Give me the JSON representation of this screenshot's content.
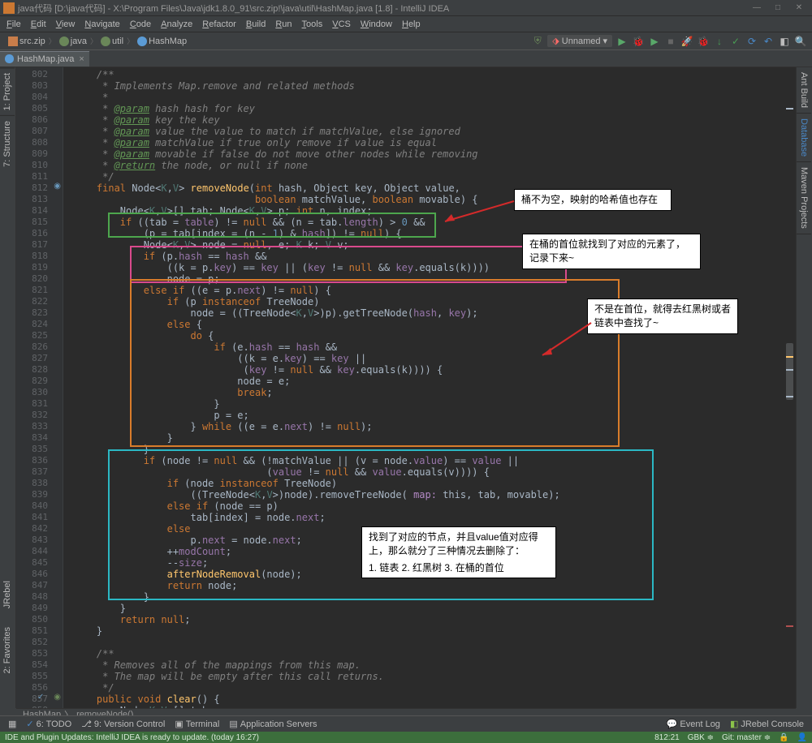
{
  "title": "java代码 [D:\\java代码] - X:\\Program Files\\Java\\jdk1.8.0_91\\src.zip!\\java\\util\\HashMap.java [1.8] - IntelliJ IDEA",
  "menu": [
    "File",
    "Edit",
    "View",
    "Navigate",
    "Code",
    "Analyze",
    "Refactor",
    "Build",
    "Run",
    "Tools",
    "VCS",
    "Window",
    "Help"
  ],
  "breadcrumbs": [
    {
      "icon": "zip",
      "label": "src.zip"
    },
    {
      "icon": "pkg",
      "label": "java"
    },
    {
      "icon": "pkg",
      "label": "util"
    },
    {
      "icon": "cls",
      "label": "HashMap"
    }
  ],
  "run_config": "Unnamed",
  "file_tab": "HashMap.java",
  "side_left": [
    "1: Project",
    "7: Structure"
  ],
  "side_left_bottom": [
    "JRebel",
    "2: Favorites"
  ],
  "side_right": [
    "Ant Build",
    "Database",
    "Maven Projects"
  ],
  "editor_footer": {
    "class": "HashMap",
    "method": "removeNode()"
  },
  "bottom_tools_left": [
    "6: TODO",
    "9: Version Control",
    "Terminal",
    "Application Servers"
  ],
  "bottom_tools_right": [
    "Event Log",
    "JRebel Console"
  ],
  "status_msg": "IDE and Plugin Updates: IntelliJ IDEA is ready to update. (today 16:27)",
  "status_right": {
    "pos": "812:21",
    "enc": "GBK",
    "git": "Git: master"
  },
  "line_start": 802,
  "code_lines": [
    {
      "t": "cmt",
      "s": "    /**"
    },
    {
      "t": "cmt",
      "s": "     * Implements Map.remove and related methods"
    },
    {
      "t": "cmt",
      "s": "     *"
    },
    {
      "t": "tag",
      "s": "     * @param hash hash for key"
    },
    {
      "t": "tag",
      "s": "     * @param key the key"
    },
    {
      "t": "tag",
      "s": "     * @param value the value to match if matchValue, else ignored"
    },
    {
      "t": "tag",
      "s": "     * @param matchValue if true only remove if value is equal"
    },
    {
      "t": "tag",
      "s": "     * @param movable if false do not move other nodes while removing"
    },
    {
      "t": "tag",
      "s": "     * @return the node, or null if none"
    },
    {
      "t": "cmt",
      "s": "     */"
    },
    {
      "t": "sig",
      "s": "    final Node<K,V> removeNode(int hash, Object key, Object value,"
    },
    {
      "t": "sig2",
      "s": "                               boolean matchValue, boolean movable) {"
    },
    {
      "t": "decl",
      "s": "        Node<K,V>[] tab; Node<K,V> p; int n, index;"
    },
    {
      "t": "code",
      "s": "        if ((tab = table) != null && (n = tab.length) > 0 &&"
    },
    {
      "t": "code",
      "s": "            (p = tab[index = (n - 1) & hash]) != null) {"
    },
    {
      "t": "decl",
      "s": "            Node<K,V> node = null, e; K k; V v;"
    },
    {
      "t": "code",
      "s": "            if (p.hash == hash &&"
    },
    {
      "t": "code",
      "s": "                ((k = p.key) == key || (key != null && key.equals(k))))"
    },
    {
      "t": "code",
      "s": "                node = p;"
    },
    {
      "t": "code",
      "s": "            else if ((e = p.next) != null) {"
    },
    {
      "t": "code",
      "s": "                if (p instanceof TreeNode)"
    },
    {
      "t": "code",
      "s": "                    node = ((TreeNode<K,V>)p).getTreeNode(hash, key);"
    },
    {
      "t": "code",
      "s": "                else {"
    },
    {
      "t": "code",
      "s": "                    do {"
    },
    {
      "t": "code",
      "s": "                        if (e.hash == hash &&"
    },
    {
      "t": "code",
      "s": "                            ((k = e.key) == key ||"
    },
    {
      "t": "code",
      "s": "                             (key != null && key.equals(k)))) {"
    },
    {
      "t": "code",
      "s": "                            node = e;"
    },
    {
      "t": "code",
      "s": "                            break;"
    },
    {
      "t": "code",
      "s": "                        }"
    },
    {
      "t": "code",
      "s": "                        p = e;"
    },
    {
      "t": "code",
      "s": "                    } while ((e = e.next) != null);"
    },
    {
      "t": "code",
      "s": "                }"
    },
    {
      "t": "code",
      "s": "            }"
    },
    {
      "t": "code",
      "s": "            if (node != null && (!matchValue || (v = node.value) == value ||"
    },
    {
      "t": "code",
      "s": "                                 (value != null && value.equals(v)))) {"
    },
    {
      "t": "code",
      "s": "                if (node instanceof TreeNode)"
    },
    {
      "t": "code",
      "s": "                    ((TreeNode<K,V>)node).removeTreeNode( map: this, tab, movable);"
    },
    {
      "t": "code",
      "s": "                else if (node == p)"
    },
    {
      "t": "code",
      "s": "                    tab[index] = node.next;"
    },
    {
      "t": "code",
      "s": "                else"
    },
    {
      "t": "code",
      "s": "                    p.next = node.next;"
    },
    {
      "t": "code",
      "s": "                ++modCount;"
    },
    {
      "t": "code",
      "s": "                --size;"
    },
    {
      "t": "mth",
      "s": "                afterNodeRemoval(node);"
    },
    {
      "t": "code",
      "s": "                return node;"
    },
    {
      "t": "code",
      "s": "            }"
    },
    {
      "t": "code",
      "s": "        }"
    },
    {
      "t": "code",
      "s": "        return null;"
    },
    {
      "t": "code",
      "s": "    }"
    },
    {
      "t": "blank",
      "s": ""
    },
    {
      "t": "cmt",
      "s": "    /**"
    },
    {
      "t": "cmt",
      "s": "     * Removes all of the mappings from this map."
    },
    {
      "t": "cmt",
      "s": "     * The map will be empty after this call returns."
    },
    {
      "t": "cmt",
      "s": "     */"
    },
    {
      "t": "sig3",
      "s": "    public void clear() {"
    },
    {
      "t": "decl",
      "s": "        Node<K,V>[] tab;"
    }
  ],
  "callouts": {
    "c1": "桶不为空，映射的哈希值也存在",
    "c2": "在桶的首位就找到了对应的元素了，记录下来~",
    "c3": "不是在首位，就得去红黑树或者链表中查找了~",
    "c4a": "找到了对应的节点，并且value值对应得上，那么就分了三种情况去删除了：",
    "c4b": "1. 链表   2. 红黑树   3. 在桶的首位"
  }
}
